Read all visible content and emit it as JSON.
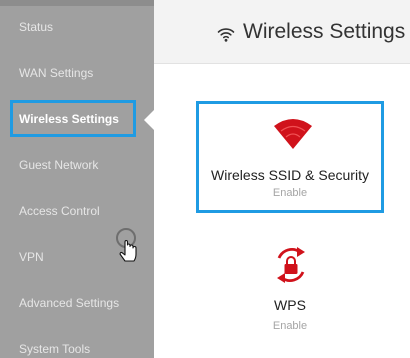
{
  "sidebar": {
    "items": [
      {
        "label": "Status"
      },
      {
        "label": "WAN Settings"
      },
      {
        "label": "Wireless Settings",
        "active": true
      },
      {
        "label": "Guest Network"
      },
      {
        "label": "Access Control"
      },
      {
        "label": "VPN"
      },
      {
        "label": "Advanced Settings"
      },
      {
        "label": "System Tools"
      }
    ]
  },
  "header": {
    "title": "Wireless Settings",
    "icon": "wifi-icon"
  },
  "cards": {
    "ssid": {
      "label": "Wireless SSID & Security",
      "status": "Enable",
      "icon": "wifi-signal-icon",
      "icon_color": "#d0121b"
    },
    "wps": {
      "label": "WPS",
      "status": "Enable",
      "icon": "wps-lock-icon",
      "icon_color": "#d0121b"
    }
  },
  "colors": {
    "sidebar_bg": "#a0a0a0",
    "selection_border": "#1f9be3",
    "accent_red": "#d0121b"
  }
}
